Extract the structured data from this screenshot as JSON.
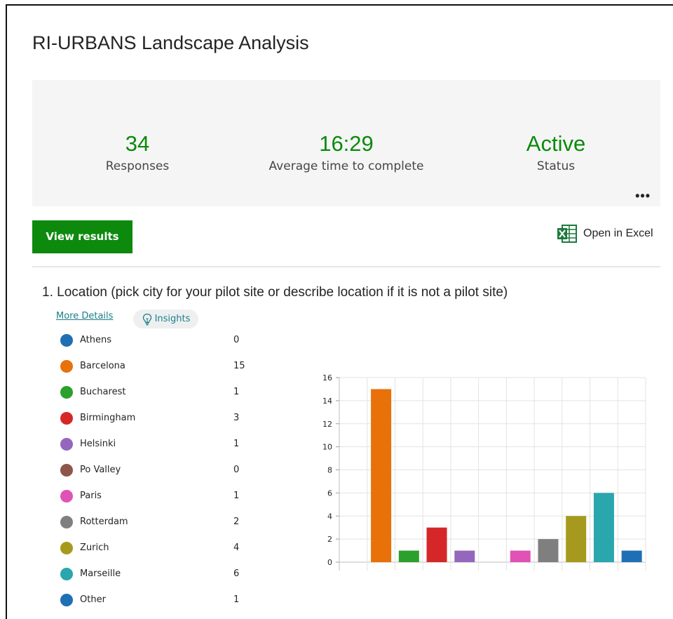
{
  "form": {
    "title": "RI-URBANS Landscape Analysis"
  },
  "summary": {
    "responses": {
      "value": "34",
      "label": "Responses"
    },
    "avg_time": {
      "value": "16:29",
      "label": "Average time to complete"
    },
    "status": {
      "value": "Active",
      "label": "Status"
    },
    "more_icon": "ellipsis-icon"
  },
  "toolbar": {
    "view_results_label": "View results",
    "open_excel_label": "Open in Excel",
    "excel_icon": "excel-icon"
  },
  "question": {
    "number": "1.",
    "text": "Location (pick city for your pilot site or describe location if it is not a pilot site)",
    "more_details_label": "More Details",
    "insights_label": "Insights",
    "insights_icon": "lightbulb-icon"
  },
  "chart_data": {
    "type": "bar",
    "categories": [
      "Athens",
      "Barcelona",
      "Bucharest",
      "Birmingham",
      "Helsinki",
      "Po Valley",
      "Paris",
      "Rotterdam",
      "Zurich",
      "Marseille",
      "Other"
    ],
    "values": [
      0,
      15,
      1,
      3,
      1,
      0,
      1,
      2,
      4,
      6,
      1
    ],
    "colors": [
      "#1f6fb5",
      "#e8710a",
      "#2ca02c",
      "#d62728",
      "#9467bd",
      "#8c564b",
      "#e052b5",
      "#7f7f7f",
      "#a69a1e",
      "#2aa6ad",
      "#1f6fb5"
    ],
    "ylim": [
      0,
      16
    ],
    "yticks": [
      0,
      2,
      4,
      6,
      8,
      10,
      12,
      14,
      16
    ],
    "grid": true,
    "legend": "left"
  }
}
